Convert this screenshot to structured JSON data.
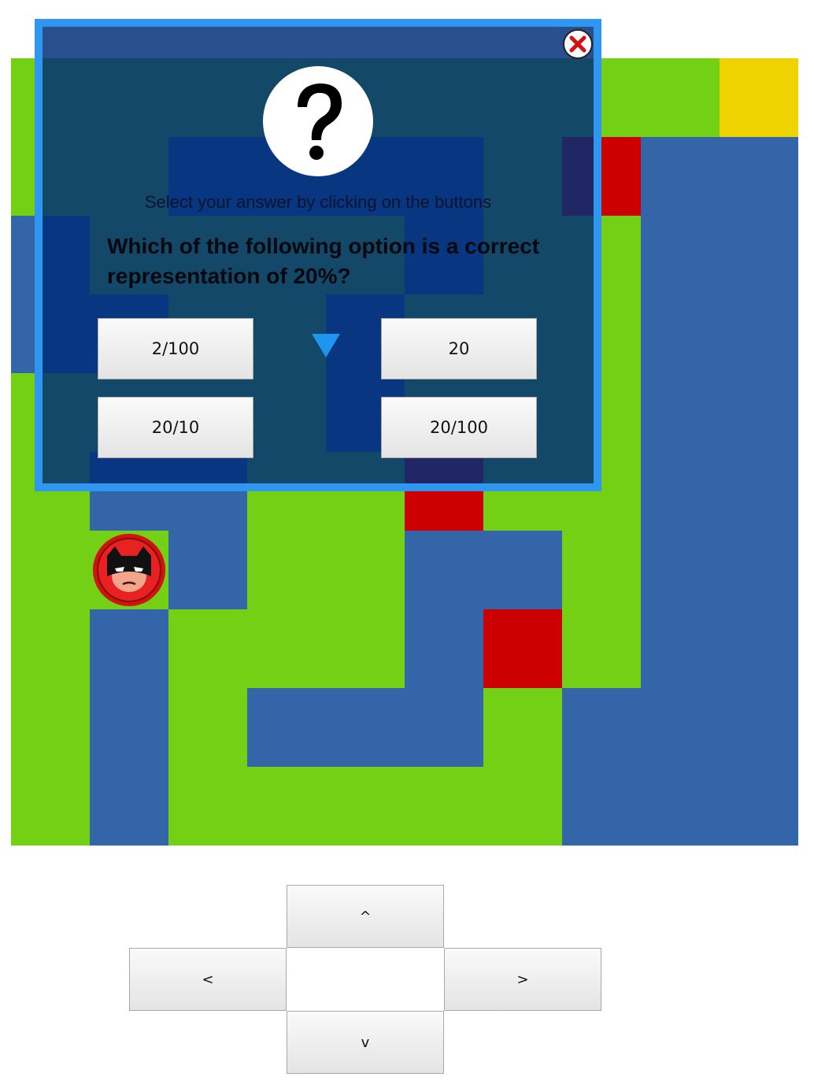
{
  "colors": {
    "path": "#74d015",
    "wall": "#3465a9",
    "trap": "#cc0000",
    "goal": "#efd300",
    "overlay_border": "#2f97ef"
  },
  "maze": {
    "legend": {
      "G": "path",
      "B": "wall",
      "R": "trap",
      "Y": "goal"
    },
    "rows": [
      "GGGGGGGGGY",
      "GGBBBBGRBB",
      "BGGGGBGGBB",
      "BBGGBGGGBB",
      "GGGGBGGGBB",
      "GBBGGRGGBB",
      "GGBGGBBGBB",
      "GBGGGBRGBB",
      "GBGBBBGBBB",
      "GBGGGGGBBB"
    ],
    "player": {
      "name": "batman-avatar",
      "row": 6,
      "col": 1
    }
  },
  "quiz": {
    "close_icon": "close-x-icon",
    "icon": "question-mark-icon",
    "instruction": "Select your answer by clicking on the buttons",
    "question": "Which of the following option is a correct representation of 20%?",
    "options": [
      "2/100",
      "20",
      "20/10",
      "20/100"
    ]
  },
  "controls": {
    "up": "^",
    "left": "<",
    "right": ">",
    "down": "v"
  }
}
